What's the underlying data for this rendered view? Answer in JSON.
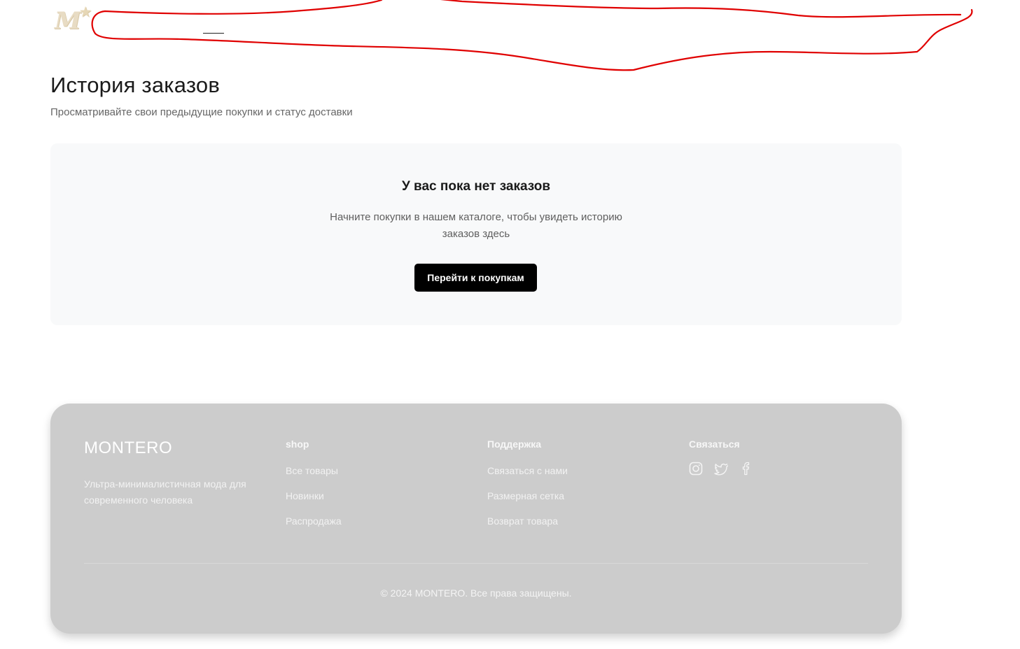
{
  "header": {
    "logo_text": "M",
    "logo_star": "★"
  },
  "main": {
    "title": "История заказов",
    "subtitle": "Просматривайте свои предыдущие покупки и статус доставки"
  },
  "empty_state": {
    "title": "У вас пока нет заказов",
    "text": "Начните покупки в нашем каталоге, чтобы увидеть историю заказов здесь",
    "button_label": "Перейти к покупкам"
  },
  "footer": {
    "brand": "MONTERO",
    "tagline": "Ультра-минималистичная мода для современного человека",
    "shop": {
      "title": "shop",
      "links": [
        "Все товары",
        "Новинки",
        "Распродажа"
      ]
    },
    "support": {
      "title": "Поддержка",
      "links": [
        "Связаться с нами",
        "Размерная сетка",
        "Возврат товара"
      ]
    },
    "contact": {
      "title": "Связаться",
      "socials": [
        "instagram-icon",
        "twitter-icon",
        "facebook-icon"
      ]
    },
    "copyright": "© 2024 MONTERO. Все права защищены."
  },
  "colors": {
    "annotation": "#e00000",
    "button_bg": "#000000",
    "footer_bg": "#cccccc",
    "card_bg": "#f8f9fa"
  }
}
